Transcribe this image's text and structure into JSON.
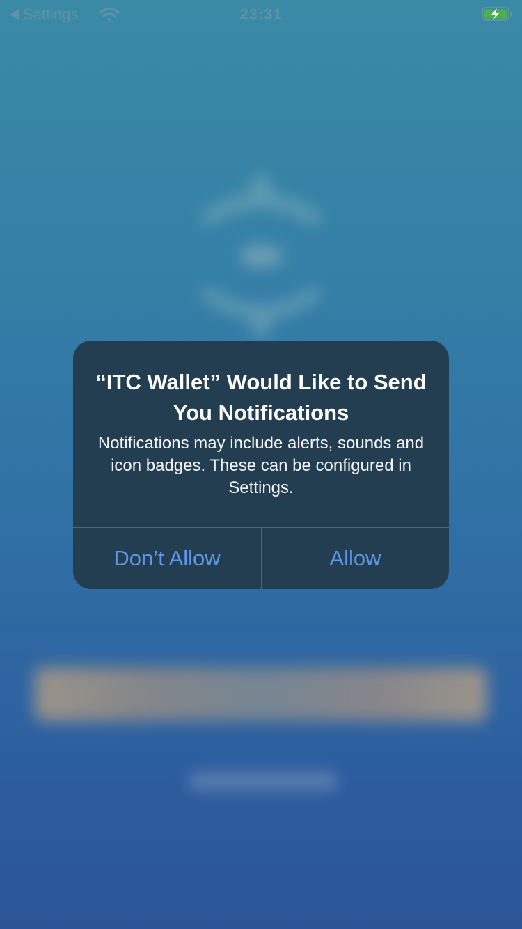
{
  "status_bar": {
    "back_label": "Settings",
    "time": "23:31",
    "back_icon": "back-triangle-icon",
    "wifi_icon": "wifi-icon",
    "battery_icon": "battery-charging-icon"
  },
  "alert": {
    "title": "“ITC Wallet” Would Like to Send You Notifications",
    "message": "Notifications may include alerts, sounds and icon badges. These can be configured in Settings.",
    "buttons": {
      "dont_allow": "Don’t Allow",
      "allow": "Allow"
    }
  },
  "colors": {
    "background_top": "#3a8aa6",
    "background_bottom": "#2b5596",
    "alert_background": "#243e51",
    "button_text": "#5d97e8",
    "battery_charge": "#4caf50"
  }
}
